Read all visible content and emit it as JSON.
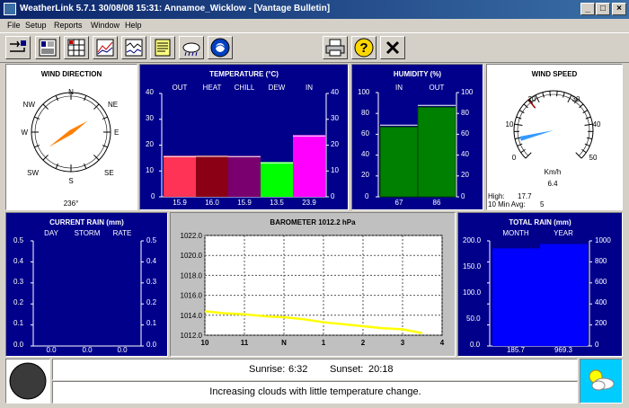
{
  "window": {
    "title": "WeatherLink 5.7.1  30/08/08  15:31: Annamoe_Wicklow - [Vantage Bulletin]",
    "controls": [
      "_",
      "□",
      "×"
    ]
  },
  "menu": [
    "File",
    "Setup",
    "Reports",
    "Window",
    "Help"
  ],
  "toolbar": {
    "icons": [
      "telemetry-icon",
      "summary-icon",
      "graph-icon",
      "strip-chart-icon",
      "notes-icon",
      "weather-icon",
      "noaa-icon",
      "print-icon",
      "help-icon",
      "close-icon"
    ],
    "help_glyph": "?",
    "close_glyph": "✕"
  },
  "wind_direction": {
    "title": "WIND DIRECTION",
    "compass": [
      "N",
      "NE",
      "E",
      "SE",
      "S",
      "SW",
      "W",
      "NW"
    ],
    "value": "236°",
    "degrees": 236
  },
  "temperature": {
    "title": "TEMPERATURE  (°C)",
    "columns": [
      "OUT",
      "HEAT",
      "CHILL",
      "DEW",
      "IN"
    ],
    "values": [
      "15.9",
      "16.0",
      "15.9",
      "13.5",
      "23.9"
    ],
    "colors": [
      "#ff3355",
      "#8b0015",
      "#7a0070",
      "#00ff00",
      "#ff00ff"
    ],
    "axis": [
      "40",
      "30",
      "20",
      "10",
      "0"
    ]
  },
  "humidity": {
    "title": "HUMIDITY  (%)",
    "columns": [
      "IN",
      "OUT"
    ],
    "values": [
      "67",
      "86"
    ],
    "axis": [
      "100",
      "80",
      "60",
      "40",
      "20",
      "0"
    ]
  },
  "wind_speed": {
    "title": "WIND SPEED",
    "scale": [
      "0",
      "10",
      "20",
      "30",
      "40",
      "50"
    ],
    "unit": "Km/h",
    "value": "6.4",
    "high_label": "High:",
    "high_value": "17.7",
    "avg_label": "10 Min Avg:",
    "avg_value": "5"
  },
  "current_rain": {
    "title": "CURRENT RAIN  (mm)",
    "columns": [
      "DAY",
      "STORM",
      "RATE"
    ],
    "values": [
      "0.0",
      "0.0",
      "0.0"
    ],
    "axis": [
      "0.5",
      "0.4",
      "0.3",
      "0.2",
      "0.1",
      "0.0"
    ]
  },
  "barometer": {
    "title": "BAROMETER 1012.2 hPa",
    "y_ticks": [
      "1022.0",
      "1020.0",
      "1018.0",
      "1016.0",
      "1014.0",
      "1012.0"
    ],
    "x_ticks": [
      "10",
      "11",
      "N",
      "1",
      "2",
      "3",
      "4"
    ]
  },
  "total_rain": {
    "title": "TOTAL RAIN  (mm)",
    "columns": [
      "MONTH",
      "YEAR"
    ],
    "values": [
      "185.7",
      "969.3"
    ],
    "left_axis": [
      "200.0",
      "150.0",
      "100.0",
      "50.0",
      "0.0"
    ],
    "right_axis": [
      "1000",
      "800",
      "600",
      "400",
      "200",
      "0"
    ]
  },
  "status": {
    "sunrise_label": "Sunrise:",
    "sunrise": "6:32",
    "sunset_label": "Sunset:",
    "sunset": "20:18",
    "forecast": "Increasing clouds with little temperature change."
  },
  "chart_data": {
    "type": "line",
    "title": "BAROMETER 1012.2 hPa",
    "xlabel": "",
    "ylabel": "",
    "x": [
      10,
      10.5,
      11,
      11.5,
      12,
      12.5,
      13,
      13.5,
      14,
      14.5,
      15,
      15.5
    ],
    "series": [
      {
        "values": [
          1014.4,
          1014.2,
          1014.1,
          1013.9,
          1013.8,
          1013.6,
          1013.3,
          1013.1,
          1012.9,
          1012.7,
          1012.6,
          1012.2
        ]
      }
    ],
    "ylim": [
      1012,
      1022
    ],
    "xlim": [
      10,
      16
    ],
    "grid": true,
    "color": "#ffff00"
  }
}
